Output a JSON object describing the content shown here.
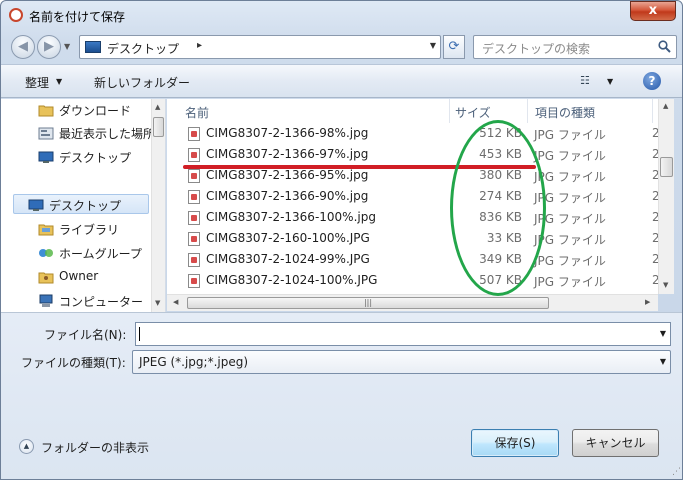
{
  "window": {
    "title": "名前を付けて保存",
    "close_label": "x"
  },
  "nav": {
    "address_label": "デスクトップ",
    "address_separator": "▸",
    "search_placeholder": "デスクトップの検索"
  },
  "toolbar": {
    "organize_label": "整理",
    "new_folder_label": "新しいフォルダー"
  },
  "nav_pane": {
    "items": [
      {
        "label": "ダウンロード",
        "icon": "download-folder-icon"
      },
      {
        "label": "最近表示した場所",
        "icon": "recent-places-icon"
      },
      {
        "label": "デスクトップ",
        "icon": "desktop-icon"
      },
      {
        "label": "デスクトップ",
        "icon": "desktop-icon",
        "selected": true
      },
      {
        "label": "ライブラリ",
        "icon": "library-icon"
      },
      {
        "label": "ホームグループ",
        "icon": "homegroup-icon"
      },
      {
        "label": "Owner",
        "icon": "user-folder-icon"
      },
      {
        "label": "コンピューター",
        "icon": "computer-icon"
      }
    ]
  },
  "file_list": {
    "columns": {
      "name": "名前",
      "size": "サイズ",
      "type": "項目の種類"
    },
    "rows": [
      {
        "name": "CIMG8307-2-1366-98%.jpg",
        "size": "512 KB",
        "type": "JPG ファイル",
        "extra": "2"
      },
      {
        "name": "CIMG8307-2-1366-97%.jpg",
        "size": "453 KB",
        "type": "JPG ファイル",
        "extra": "2"
      },
      {
        "name": "CIMG8307-2-1366-95%.jpg",
        "size": "380 KB",
        "type": "JPG ファイル",
        "extra": "2"
      },
      {
        "name": "CIMG8307-2-1366-90%.jpg",
        "size": "274 KB",
        "type": "JPG ファイル",
        "extra": "2"
      },
      {
        "name": "CIMG8307-2-1366-100%.jpg",
        "size": "836 KB",
        "type": "JPG ファイル",
        "extra": "2"
      },
      {
        "name": "CIMG8307-2-160-100%.JPG",
        "size": "33 KB",
        "type": "JPG ファイル",
        "extra": "2"
      },
      {
        "name": "CIMG8307-2-1024-99%.JPG",
        "size": "349 KB",
        "type": "JPG ファイル",
        "extra": "2"
      },
      {
        "name": "CIMG8307-2-1024-100%.JPG",
        "size": "507 KB",
        "type": "JPG ファイル",
        "extra": "2"
      }
    ]
  },
  "form": {
    "filename_label": "ファイル名(N):",
    "filename_value": "",
    "filetype_label": "ファイルの種類(T):",
    "filetype_value": "JPEG (*.jpg;*.jpeg)"
  },
  "footer": {
    "hide_folders_label": "フォルダーの非表示",
    "save_label": "保存(S)",
    "cancel_label": "キャンセル"
  },
  "annotations": {
    "strike_color": "#d11e25",
    "highlight_color": "#23a64a"
  }
}
